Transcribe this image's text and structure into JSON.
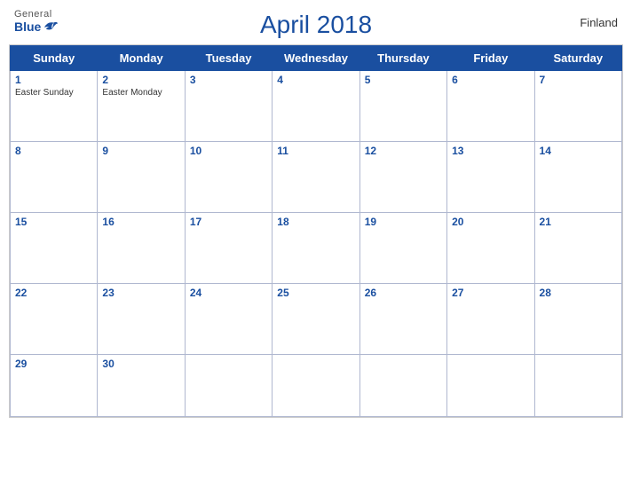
{
  "header": {
    "title": "April 2018",
    "country": "Finland",
    "logo": {
      "general": "General",
      "blue": "Blue"
    }
  },
  "days_of_week": [
    "Sunday",
    "Monday",
    "Tuesday",
    "Wednesday",
    "Thursday",
    "Friday",
    "Saturday"
  ],
  "weeks": [
    [
      {
        "num": "1",
        "holiday": "Easter Sunday"
      },
      {
        "num": "2",
        "holiday": "Easter Monday"
      },
      {
        "num": "3",
        "holiday": ""
      },
      {
        "num": "4",
        "holiday": ""
      },
      {
        "num": "5",
        "holiday": ""
      },
      {
        "num": "6",
        "holiday": ""
      },
      {
        "num": "7",
        "holiday": ""
      }
    ],
    [
      {
        "num": "8",
        "holiday": ""
      },
      {
        "num": "9",
        "holiday": ""
      },
      {
        "num": "10",
        "holiday": ""
      },
      {
        "num": "11",
        "holiday": ""
      },
      {
        "num": "12",
        "holiday": ""
      },
      {
        "num": "13",
        "holiday": ""
      },
      {
        "num": "14",
        "holiday": ""
      }
    ],
    [
      {
        "num": "15",
        "holiday": ""
      },
      {
        "num": "16",
        "holiday": ""
      },
      {
        "num": "17",
        "holiday": ""
      },
      {
        "num": "18",
        "holiday": ""
      },
      {
        "num": "19",
        "holiday": ""
      },
      {
        "num": "20",
        "holiday": ""
      },
      {
        "num": "21",
        "holiday": ""
      }
    ],
    [
      {
        "num": "22",
        "holiday": ""
      },
      {
        "num": "23",
        "holiday": ""
      },
      {
        "num": "24",
        "holiday": ""
      },
      {
        "num": "25",
        "holiday": ""
      },
      {
        "num": "26",
        "holiday": ""
      },
      {
        "num": "27",
        "holiday": ""
      },
      {
        "num": "28",
        "holiday": ""
      }
    ],
    [
      {
        "num": "29",
        "holiday": ""
      },
      {
        "num": "30",
        "holiday": ""
      },
      {
        "num": "",
        "holiday": ""
      },
      {
        "num": "",
        "holiday": ""
      },
      {
        "num": "",
        "holiday": ""
      },
      {
        "num": "",
        "holiday": ""
      },
      {
        "num": "",
        "holiday": ""
      }
    ]
  ]
}
